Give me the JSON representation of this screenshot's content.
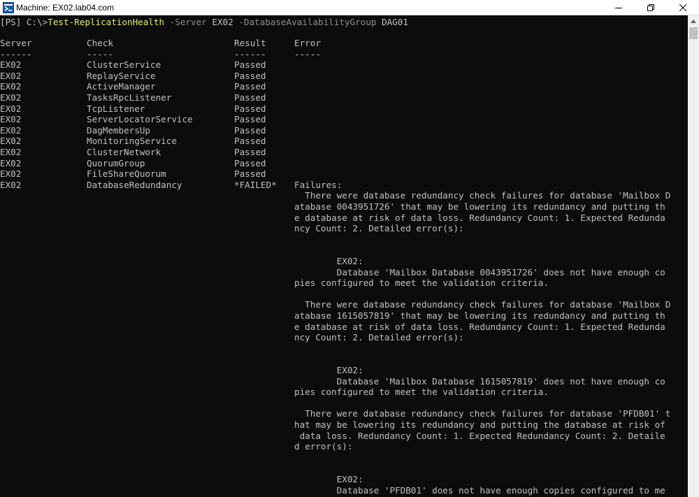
{
  "window": {
    "title": "Machine: EX02.lab04.com",
    "controls": [
      "minimize",
      "restore",
      "close"
    ]
  },
  "command": {
    "prompt": "[PS] C:\\>",
    "cmdlet": "Test-ReplicationHealth",
    "param1": "-Server",
    "value1": "EX02",
    "param2": "-DatabaseAvailabilityGroup",
    "value2": "DAG01"
  },
  "table": {
    "headers": [
      "Server",
      "Check",
      "Result",
      "Error"
    ],
    "separators": [
      "------",
      "-----",
      "------",
      "-----"
    ],
    "rows": [
      {
        "server": "EX02",
        "check": "ClusterService",
        "result": "Passed"
      },
      {
        "server": "EX02",
        "check": "ReplayService",
        "result": "Passed"
      },
      {
        "server": "EX02",
        "check": "ActiveManager",
        "result": "Passed"
      },
      {
        "server": "EX02",
        "check": "TasksRpcListener",
        "result": "Passed"
      },
      {
        "server": "EX02",
        "check": "TcpListener",
        "result": "Passed"
      },
      {
        "server": "EX02",
        "check": "ServerLocatorService",
        "result": "Passed"
      },
      {
        "server": "EX02",
        "check": "DagMembersUp",
        "result": "Passed"
      },
      {
        "server": "EX02",
        "check": "MonitoringService",
        "result": "Passed"
      },
      {
        "server": "EX02",
        "check": "ClusterNetwork",
        "result": "Passed"
      },
      {
        "server": "EX02",
        "check": "QuorumGroup",
        "result": "Passed"
      },
      {
        "server": "EX02",
        "check": "FileShareQuorum",
        "result": "Passed"
      },
      {
        "server": "EX02",
        "check": "DatabaseRedundancy",
        "result": "*FAILED*"
      }
    ]
  },
  "error_lines": [
    "Failures:",
    "  There were database redundancy check failures for database 'Mailbox D",
    "atabase 0043951726' that may be lowering its redundancy and putting th",
    "e database at risk of data loss. Redundancy Count: 1. Expected Redunda",
    "ncy Count: 2. Detailed error(s):",
    "",
    "",
    "        EX02:",
    "        Database 'Mailbox Database 0043951726' does not have enough co",
    "pies configured to meet the validation criteria.",
    "",
    "  There were database redundancy check failures for database 'Mailbox D",
    "atabase 1615057819' that may be lowering its redundancy and putting th",
    "e database at risk of data loss. Redundancy Count: 1. Expected Redunda",
    "ncy Count: 2. Detailed error(s):",
    "",
    "",
    "        EX02:",
    "        Database 'Mailbox Database 1615057819' does not have enough co",
    "pies configured to meet the validation criteria.",
    "",
    "  There were database redundancy check failures for database 'PFDB01' t",
    "hat may be lowering its redundancy and putting the database at risk of",
    " data loss. Redundancy Count: 1. Expected Redundancy Count: 2. Detaile",
    "d error(s):",
    "",
    "",
    "        EX02:",
    "        Database 'PFDB01' does not have enough copies configured to me"
  ],
  "colors": {
    "background": "#0c0c0c",
    "text": "#c0c0c0",
    "command": "#e6e676",
    "parameter": "#8e8e8e"
  }
}
